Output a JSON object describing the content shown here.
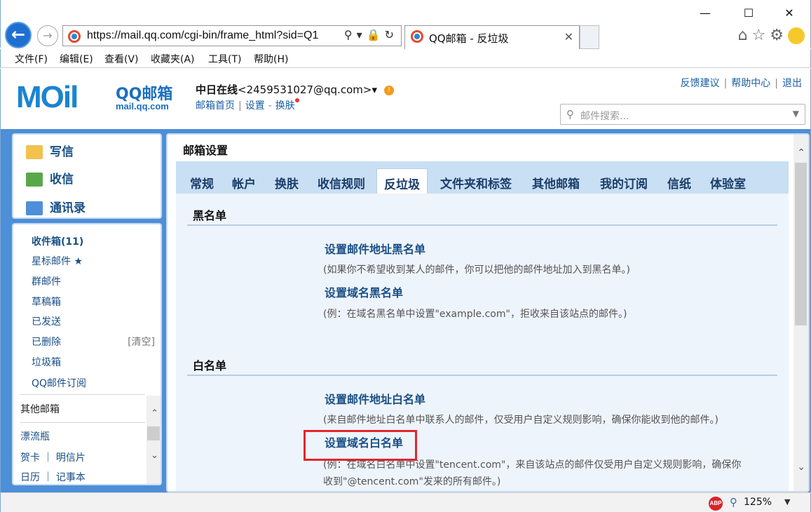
{
  "browser": {
    "url": "https://mail.qq.com/cgi-bin/frame_html?sid=Q1",
    "tab_title": "QQ邮箱 - 反垃圾",
    "close_tab": "✕",
    "menu": [
      "文件(F)",
      "编辑(E)",
      "查看(V)",
      "收藏夹(A)",
      "工具(T)",
      "帮助(H)"
    ],
    "window_controls": [
      "—",
      "☐",
      "✕"
    ],
    "icons": [
      "home-icon",
      "star-icon",
      "gear-icon",
      "smiley-icon"
    ]
  },
  "header": {
    "logo_text": "MOil",
    "logo_brand": "QQ邮箱",
    "logo_domain": "mail.qq.com",
    "user_name": "中日在线",
    "user_email": "<2459531027@qq.com>",
    "user_dropdown": "▾",
    "links": [
      "邮箱首页",
      "设置",
      "换肤"
    ],
    "top_links": [
      "反馈建议",
      "帮助中心",
      "退出"
    ],
    "search_placeholder": "邮件搜索..."
  },
  "sidebar": {
    "actions": [
      {
        "label": "写信",
        "icon": "compose-icon"
      },
      {
        "label": "收信",
        "icon": "inbox-download-icon"
      },
      {
        "label": "通讯录",
        "icon": "contacts-icon"
      }
    ],
    "folders": [
      {
        "label": "收件箱(11)"
      },
      {
        "label": "星标邮件 ★"
      },
      {
        "label": "群邮件"
      },
      {
        "label": "草稿箱"
      },
      {
        "label": "已发送"
      },
      {
        "label": "已删除",
        "extra": "[清空]"
      },
      {
        "label": "垃圾箱"
      },
      {
        "label": "QQ邮件订阅"
      }
    ],
    "other_folders": [
      {
        "label": "其他邮箱"
      },
      {
        "label": "漂流瓶"
      },
      {
        "label": "贺卡 ｜ 明信片"
      },
      {
        "label": "日历 ｜ 记事本"
      }
    ]
  },
  "main": {
    "title": "邮箱设置",
    "tabs": [
      "常规",
      "帐户",
      "换肤",
      "收信规则",
      "反垃圾",
      "文件夹和标签",
      "其他邮箱",
      "我的订阅",
      "信纸",
      "体验室"
    ],
    "active_tab": "反垃圾",
    "blacklist": {
      "heading": "黑名单",
      "items": [
        {
          "link": "设置邮件地址黑名单",
          "desc": "(如果你不希望收到某人的邮件，你可以把他的邮件地址加入到黑名单。)"
        },
        {
          "link": "设置域名黑名单",
          "desc": "(例：在域名黑名单中设置\"example.com\"，拒收来自该站点的邮件。)"
        }
      ]
    },
    "whitelist": {
      "heading": "白名单",
      "items": [
        {
          "link": "设置邮件地址白名单",
          "desc": "(来自邮件地址白名单中联系人的邮件，仅受用户自定义规则影响，确保你能收到他的邮件。)"
        },
        {
          "link": "设置域名白名单",
          "desc": "(例：在域名白名单中设置\"tencent.com\"，来自该站点的邮件仅受用户自定义规则影响，确保你",
          "desc2": "收到\"@tencent.com\"发来的所有邮件。)"
        }
      ]
    }
  },
  "status": {
    "abp": "ABP",
    "zoom": "125%"
  },
  "colors": {
    "page_blue": "#4d8fd8",
    "link_blue": "#1a4f86",
    "highlight": "#e3262e",
    "tab_strip": "#c9dff3"
  }
}
